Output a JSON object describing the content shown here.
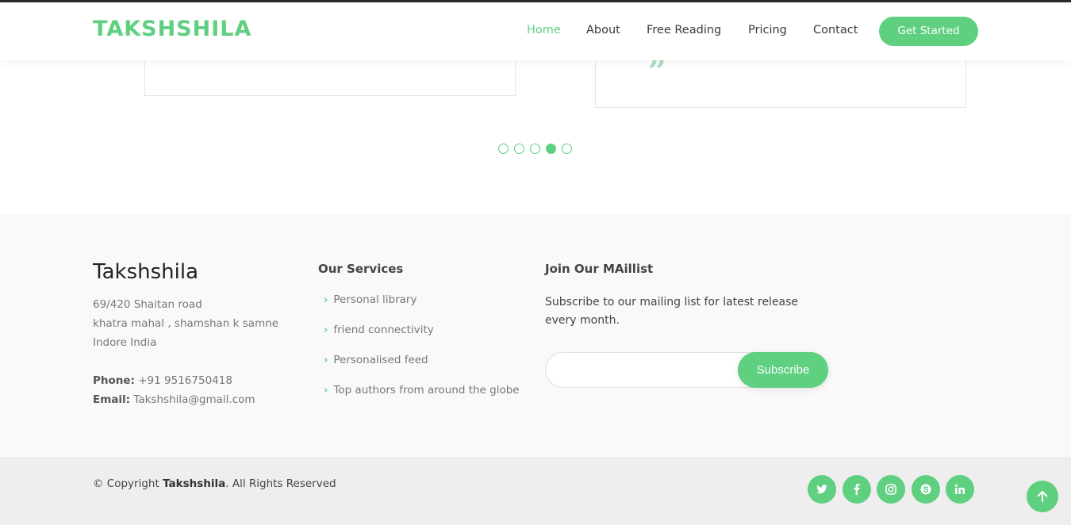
{
  "header": {
    "logo": "TAKSHSHILA",
    "nav": [
      {
        "label": "Home",
        "active": true
      },
      {
        "label": "About",
        "active": false
      },
      {
        "label": "Free Reading",
        "active": false
      },
      {
        "label": "Pricing",
        "active": false
      },
      {
        "label": "Contact",
        "active": false
      }
    ],
    "cta_label": "Get Started"
  },
  "testimonials": {
    "quote_icon": "quote-icon",
    "slider": {
      "total_slides": 5,
      "active_slide": 4
    }
  },
  "footer": {
    "brand": "Takshshila",
    "address": [
      "69/420 Shaitan road",
      "khatra mahal , shamshan k samne",
      "Indore India"
    ],
    "phone_label": "Phone:",
    "phone": "+91 9516750418",
    "email_label": "Email:",
    "email": "Takshshila@gmail.com",
    "services_title": "Our Services",
    "services": [
      "Personal library",
      "friend connectivity",
      "Personalised feed",
      "Top authors from around the globe"
    ],
    "mail_title": "Join Our MAillist",
    "mail_text": "Subscribe to our mailing list for latest release every month.",
    "email_input_value": "",
    "subscribe_label": "Subscribe",
    "copyright_prefix": "© Copyright",
    "copyright_brand": "Takshshila",
    "copyright_suffix": ". All Rights Reserved",
    "social_icons": [
      "twitter-icon",
      "facebook-icon",
      "instagram-icon",
      "skype-icon",
      "linkedin-icon"
    ]
  },
  "colors": {
    "accent": "#5fcf80",
    "footer_bg": "#f9f9f9",
    "footer_bottom_bg": "#eeeeee"
  }
}
